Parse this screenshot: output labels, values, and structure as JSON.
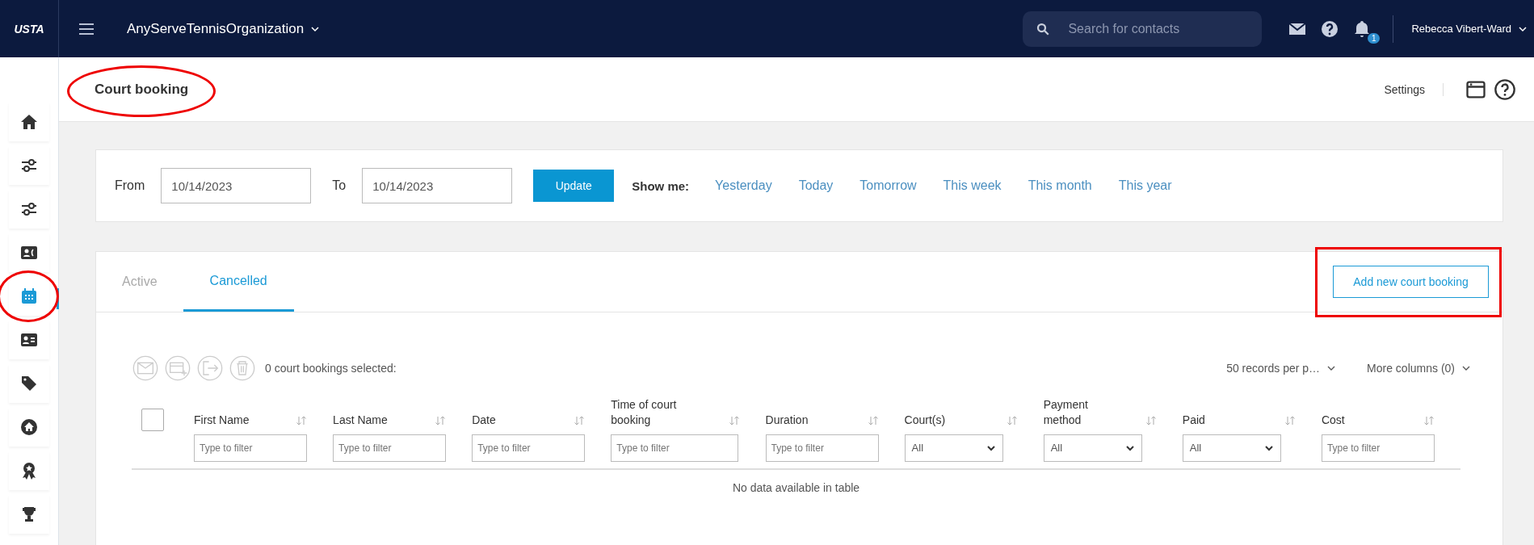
{
  "topbar": {
    "logo": "USTA",
    "organization": "AnyServeTennisOrganization",
    "search": {
      "placeholder": "Search for contacts"
    },
    "notification_count": "1",
    "user": "Rebecca Vibert-Ward"
  },
  "sidebar": {
    "items": [
      {
        "kind": "home",
        "selected": false,
        "marked": false
      },
      {
        "kind": "sliders",
        "selected": false,
        "marked": false
      },
      {
        "kind": "sliders",
        "selected": false,
        "marked": false
      },
      {
        "kind": "contact",
        "selected": false,
        "marked": false
      },
      {
        "kind": "calendar",
        "selected": true,
        "marked": true
      },
      {
        "kind": "idcard",
        "selected": false,
        "marked": false
      },
      {
        "kind": "tags",
        "selected": false,
        "marked": false
      },
      {
        "kind": "homecircle",
        "selected": false,
        "marked": false
      },
      {
        "kind": "award",
        "selected": false,
        "marked": false
      },
      {
        "kind": "trophy",
        "selected": false,
        "marked": false
      }
    ]
  },
  "header": {
    "title": "Court booking",
    "title_marked": true,
    "settings": "Settings"
  },
  "date_filter": {
    "from_label": "From",
    "from_value": "10/14/2023",
    "to_label": "To",
    "to_value": "10/14/2023",
    "update": "Update",
    "show_me": "Show me:",
    "ranges": [
      "Yesterday",
      "Today",
      "Tomorrow",
      "This week",
      "This month",
      "This year"
    ]
  },
  "tabs": [
    {
      "label": "Active",
      "selected": false
    },
    {
      "label": "Cancelled",
      "selected": true
    }
  ],
  "add_button": {
    "label": "Add new court booking",
    "marked": true
  },
  "toolbar": {
    "selected_count": "0 court bookings selected:",
    "per_page": "50 records per p…",
    "more_columns": "More columns (0)"
  },
  "table": {
    "select_all": {
      "checked": false
    },
    "columns": [
      {
        "label": "First Name",
        "kind": "text",
        "placeholder": "Type to filter"
      },
      {
        "label": "Last Name",
        "kind": "text",
        "placeholder": "Type to filter"
      },
      {
        "label": "Date",
        "kind": "text",
        "placeholder": "Type to filter"
      },
      {
        "label": "Time of court booking",
        "kind": "text",
        "placeholder": "Type to filter"
      },
      {
        "label": "Duration",
        "kind": "text",
        "placeholder": "Type to filter"
      },
      {
        "label": "Court(s)",
        "kind": "select",
        "value": "All"
      },
      {
        "label": "Payment method",
        "kind": "select",
        "value": "All"
      },
      {
        "label": "Paid",
        "kind": "select",
        "value": "All"
      },
      {
        "label": "Cost",
        "kind": "text",
        "placeholder": "Type to filter"
      }
    ],
    "empty_message": "No data available in table"
  }
}
